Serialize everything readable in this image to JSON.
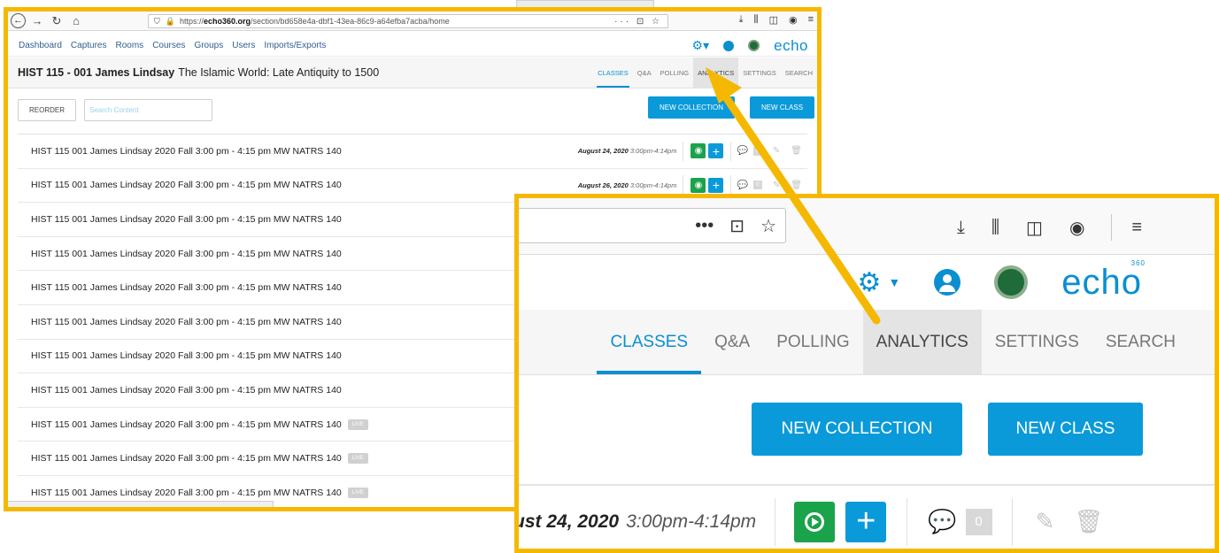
{
  "browser": {
    "url_host": "echo360.org",
    "url_prefix": "https://",
    "url_path": "/section/bd658e4a-dbf1-43ea-86c9-a64efba7acba/home",
    "url_actions": "··· ⊡ ☆"
  },
  "appnav": {
    "items": [
      "Dashboard",
      "Captures",
      "Rooms",
      "Courses",
      "Groups",
      "Users",
      "Imports/Exports"
    ],
    "logo": "echo",
    "logo_sup": "360"
  },
  "course": {
    "code": "HIST 115 - 001 James Lindsay",
    "title": "The Islamic World: Late Antiquity to 1500",
    "tabs": [
      "CLASSES",
      "Q&A",
      "POLLING",
      "ANALYTICS",
      "SETTINGS",
      "SEARCH"
    ]
  },
  "actions": {
    "reorder": "REORDER",
    "search_placeholder": "Search Content",
    "new_collection": "NEW COLLECTION",
    "new_class": "NEW CLASS"
  },
  "classes": {
    "row_title": "HIST 115 001 James Lindsay 2020 Fall 3:00 pm - 4:15 pm MW NATRS 140",
    "live_label": "LIVE",
    "count_zero": "0",
    "row1_date": "August 24, 2020",
    "row1_time": "3:00pm-4:14pm",
    "row2_date": "August 26, 2020",
    "row2_time": "3:00pm-4:14pm"
  },
  "zoom": {
    "date_partial": "ust 24, 2020",
    "time": "3:00pm-4:14pm",
    "count_zero": "0"
  },
  "colors": {
    "highlight_border": "#f5b800",
    "accent_blue": "#0a9ad9",
    "green": "#1aa34a"
  }
}
